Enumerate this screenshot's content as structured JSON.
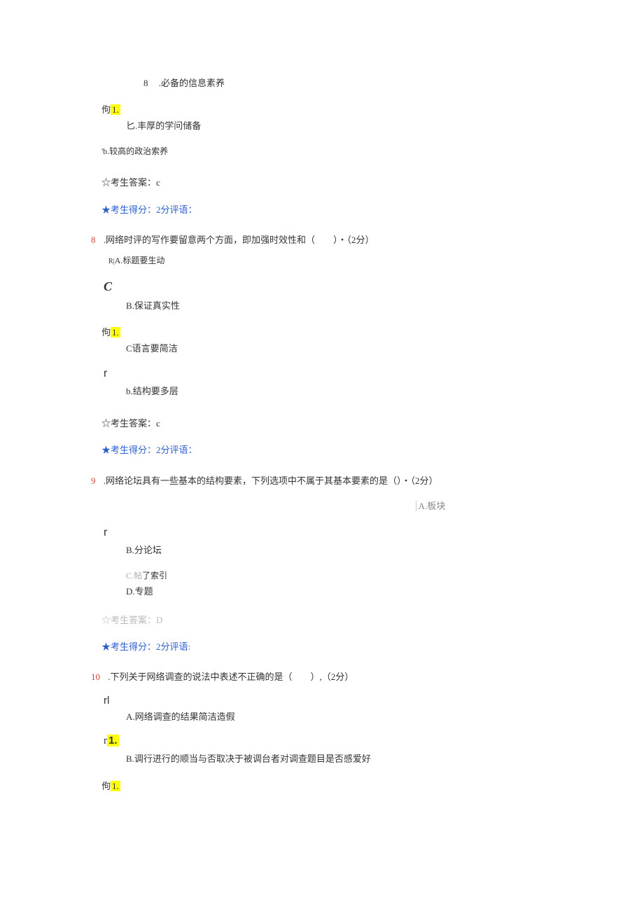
{
  "q7_tail": {
    "num_label": "8",
    "opt_a_text": ".必备的信息素养",
    "gou_prefix": "佝",
    "gou_highlight": "1.",
    "opt_c_text": "匕.丰厚的学问储备",
    "opt_d_text": "'b.较高的政治索养",
    "answer_label": "☆考生答案：c",
    "score_star": "★考生",
    "score_rest": "得分：2分评语："
  },
  "q8": {
    "num": "8",
    "question": ".网络时评的写作要留意两个方面，即加强时效性和（　　）・（2分）",
    "opt_a_prefix": "R|",
    "opt_a": "A.标题要生动",
    "c_mark": "C",
    "opt_b": "B.保证真实性",
    "gou_prefix": "佝",
    "gou_highlight": "1.",
    "opt_c": "C语言要简洁",
    "r_mark": "r",
    "opt_d": "b.结构要多层",
    "answer_label": "☆考生答案：c",
    "score_star": "★考生",
    "score_rest": "得分：2分评语："
  },
  "q9": {
    "num": "9",
    "question": ".网络论坛具有一些基本的结构要素，下列选项中不属于其基本要素的是（）・（2分）",
    "opt_a": "A.板块",
    "r_mark": "r",
    "opt_b": "B.分论坛",
    "opt_c_gray": "C.帖",
    "opt_c_dark": "了索引",
    "opt_d": "D.专题",
    "answer_label": "☆考生答案：D",
    "score_star": "★考生",
    "score_rest": "得分：2分评语:"
  },
  "q10": {
    "num": "10",
    "question": ".下列关于网络调查的说法中表述不正确的是（　　）,（2分）",
    "rl_mark": "rl",
    "opt_a": "A.网络调查的结果简洁造假",
    "r1_mark": "r",
    "r1_highlight": "1.",
    "opt_b": "B.调行进行的顺当与否取决于被调台者对调查题目是否感爱好",
    "gou_prefix": "佝",
    "gou_highlight": "1."
  }
}
